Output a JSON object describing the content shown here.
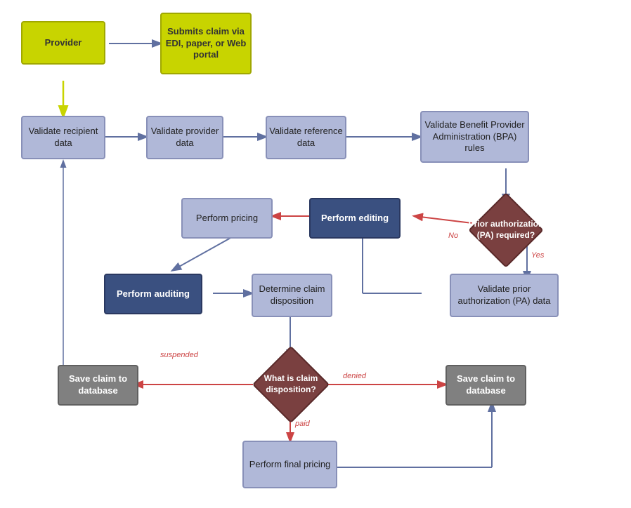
{
  "nodes": {
    "provider": {
      "label": "Provider"
    },
    "submitsClaim": {
      "label": "Submits claim via EDI, paper, or Web portal"
    },
    "validateRecipient": {
      "label": "Validate recipient data"
    },
    "validateProvider": {
      "label": "Validate provider data"
    },
    "validateReference": {
      "label": "Validate reference data"
    },
    "validateBPA": {
      "label": "Validate Benefit Provider Administration (BPA) rules"
    },
    "priorAuth": {
      "label": "Prior authorization (PA) required?"
    },
    "performPricing": {
      "label": "Perform pricing"
    },
    "performEditing": {
      "label": "Perform editing"
    },
    "performAuditing": {
      "label": "Perform auditing"
    },
    "determineDisposition": {
      "label": "Determine claim disposition"
    },
    "validatePA": {
      "label": "Validate prior authorization (PA) data"
    },
    "claimDisposition": {
      "label": "What is claim disposition?"
    },
    "saveClaimLeft": {
      "label": "Save claim to database"
    },
    "saveClaimRight": {
      "label": "Save claim to database"
    },
    "performFinalPricing": {
      "label": "Perform final pricing"
    }
  },
  "labels": {
    "no": "No",
    "yes": "Yes",
    "suspended": "suspended",
    "denied": "denied",
    "paid": "paid"
  }
}
